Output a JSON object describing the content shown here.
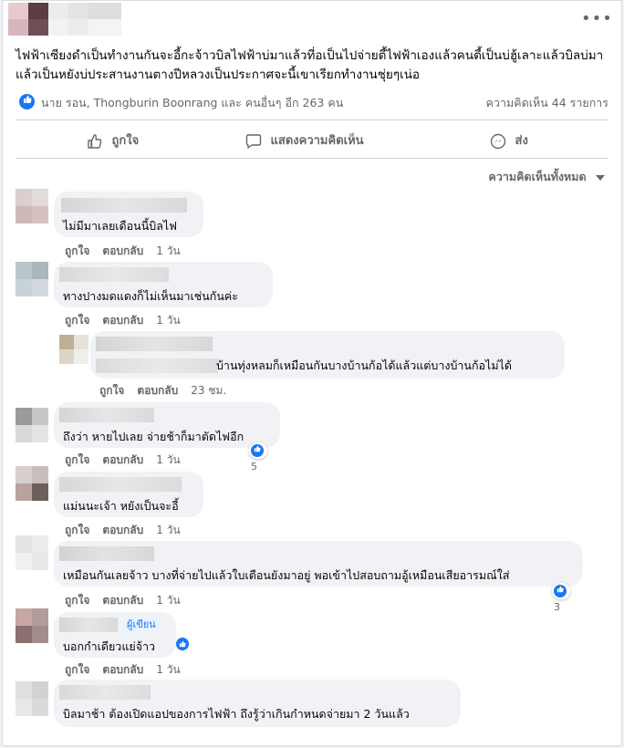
{
  "post": {
    "text": "ไฟฟ้าเซียงดำเป็นทำงานกันจะอี้กะจ้าวบิลไฟฟ้าบ่มาแล้วที่อเป็นไปจ่ายตี้ไฟฟ้าเองแล้วคนตี้เป็นบ่ฮู้เลาะแล้วบิลบ่มาแล้วเป็นหยังบ่ประสานงานตางปีหลวงเป็นประกาศจะนี้เขาเรียกทำงานชุ่ยๆเน่อ",
    "reactions_text": "นาย รอน, Thongburin Boonrang และ คนอื่นๆ อีก 263 คน",
    "comments_count": "ความคิดเห็น 44 รายการ",
    "more_label": "•••"
  },
  "actions": {
    "like": "ถูกใจ",
    "comment": "แสดงความคิดเห็น",
    "share": "ส่ง"
  },
  "sort_label": "ความคิดเห็นทั้งหมด",
  "comment_actions": {
    "like": "ถูกใจ",
    "reply": "ตอบกลับ"
  },
  "comments": [
    {
      "text": "ไม่มีมาเลยเดือนนี้บิลไฟ",
      "time": "1 วัน"
    },
    {
      "text": "ทางปางมดแดงก็ไม่เห็นมาเช่นกันค่ะ",
      "time": "1 วัน"
    },
    {
      "text": "บ้านทุ่งหลมก็เหมือนกันบางบ้านก้อได้แล้วแต่บางบ้านก้อไม่ได้",
      "time": "23 ชม."
    },
    {
      "text": "ถึงว่า หายไปเลย จ่ายช้าก็มาตัดไฟอีก",
      "time": "1 วัน",
      "reactions": "5"
    },
    {
      "text": "แม่นนะเจ้า หยังเป็นจะอี้",
      "time": "1 วัน"
    },
    {
      "text": "เหมือนกันเลยจ้าว บางที่จ่ายไปแล้วใบเตือนยังมาอยู่ พอเข้าไปสอบถามอู้เหมือนเสียอารมณ์ใส่",
      "time": "1 วัน",
      "reactions": "3"
    },
    {
      "text": "บอกกำเดียวแย่จ้าว",
      "time": "1 วัน",
      "author_tag": "ผู้เขียน"
    },
    {
      "text": "บิลมาช้า ต้องเปิดแอปของการไฟฟ้า ถึงรู้ว่าเกินกำหนดจ่ายมา 2 วันแล้ว",
      "time": "1 วัน"
    }
  ],
  "colors": {
    "accent": "#1877f2",
    "muted": "#65676b",
    "bubble": "#f0f2f5"
  }
}
